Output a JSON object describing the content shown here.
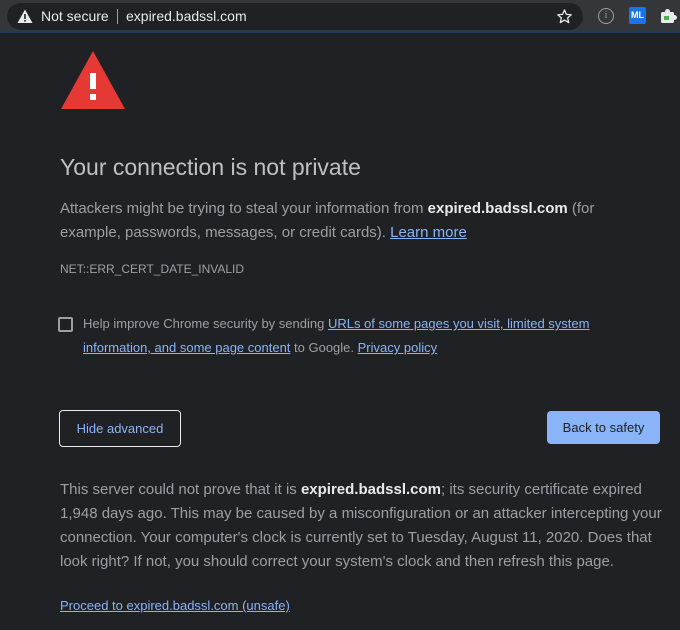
{
  "toolbar": {
    "security_label": "Not secure",
    "url": "expired.badssl.com",
    "extensions": {
      "ml_label": "ML",
      "info_label": "i"
    },
    "icons": [
      "warning-triangle-icon",
      "bookmark-star-icon",
      "info-circle-icon",
      "ml-extension-icon",
      "puzzle-extension-icon"
    ]
  },
  "page": {
    "heading": "Your connection is not private",
    "intro": {
      "text_before": "Attackers might be trying to steal your information from ",
      "domain": "expired.badssl.com",
      "text_after": " (for example, passwords, messages, or credit cards). ",
      "learn_more": "Learn more"
    },
    "error_code": "NET::ERR_CERT_DATE_INVALID",
    "opt_in": {
      "checked": false,
      "text_before": "Help improve Chrome security by sending ",
      "link": "URLs of some pages you visit, limited system information, and some page content",
      "text_middle": " to Google. ",
      "privacy_link": "Privacy policy"
    },
    "buttons": {
      "hide_advanced": "Hide advanced",
      "back_to_safety": "Back to safety"
    },
    "details": {
      "text_before": "This server could not prove that it is ",
      "domain": "expired.badssl.com",
      "text_after": "; its security certificate expired 1,948 days ago. This may be caused by a misconfiguration or an attacker intercepting your connection. Your computer's clock is currently set to Tuesday, August 11, 2020. Does that look right? If not, you should correct your system's clock and then refresh this page."
    },
    "proceed_link": "Proceed to expired.badssl.com (unsafe)"
  },
  "colors": {
    "background": "#202124",
    "toolbar": "#35363a",
    "link": "#8ab4f8",
    "danger": "#e53935",
    "primary_button": "#8ab4f8"
  }
}
